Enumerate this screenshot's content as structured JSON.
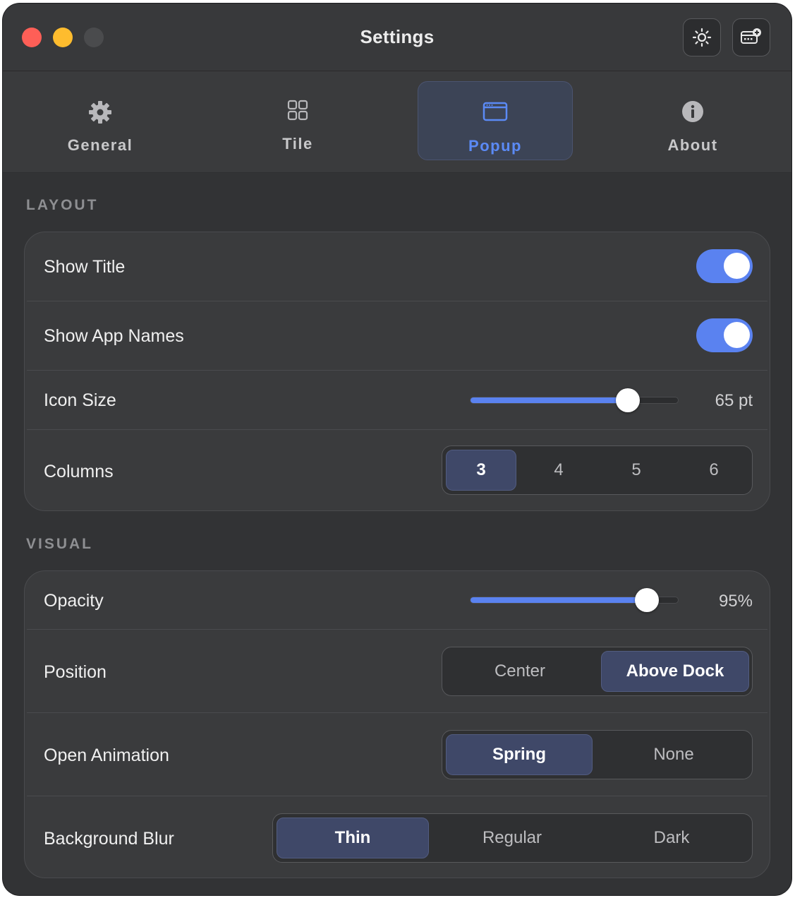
{
  "window": {
    "title": "Settings"
  },
  "toolbar": {
    "buttons": [
      {
        "icon": "sun-icon"
      },
      {
        "icon": "card-add-icon"
      }
    ]
  },
  "tabs": [
    {
      "label": "General",
      "icon": "gear-icon",
      "active": false
    },
    {
      "label": "Tile",
      "icon": "grid-icon",
      "active": false
    },
    {
      "label": "Popup",
      "icon": "window-icon",
      "active": true
    },
    {
      "label": "About",
      "icon": "info-icon",
      "active": false
    }
  ],
  "layout": {
    "heading": "LAYOUT",
    "show_title": {
      "label": "Show Title",
      "on": true
    },
    "show_app_names": {
      "label": "Show App Names",
      "on": true
    },
    "icon_size": {
      "label": "Icon Size",
      "value_text": "65 pt",
      "fraction": 0.76
    },
    "columns": {
      "label": "Columns",
      "options": [
        "3",
        "4",
        "5",
        "6"
      ],
      "selected": "3"
    }
  },
  "visual": {
    "heading": "VISUAL",
    "opacity": {
      "label": "Opacity",
      "value_text": "95%",
      "fraction": 0.85
    },
    "position": {
      "label": "Position",
      "options": [
        "Center",
        "Above Dock"
      ],
      "selected": "Above Dock"
    },
    "open_animation": {
      "label": "Open Animation",
      "options": [
        "Spring",
        "None"
      ],
      "selected": "Spring"
    },
    "background_blur": {
      "label": "Background Blur",
      "options": [
        "Thin",
        "Regular",
        "Dark"
      ],
      "selected": "Thin"
    }
  },
  "colors": {
    "accent": "#5a82f0",
    "active_tab_text": "#5b8af5",
    "close": "#fe5f57",
    "minimize": "#febc2e"
  }
}
